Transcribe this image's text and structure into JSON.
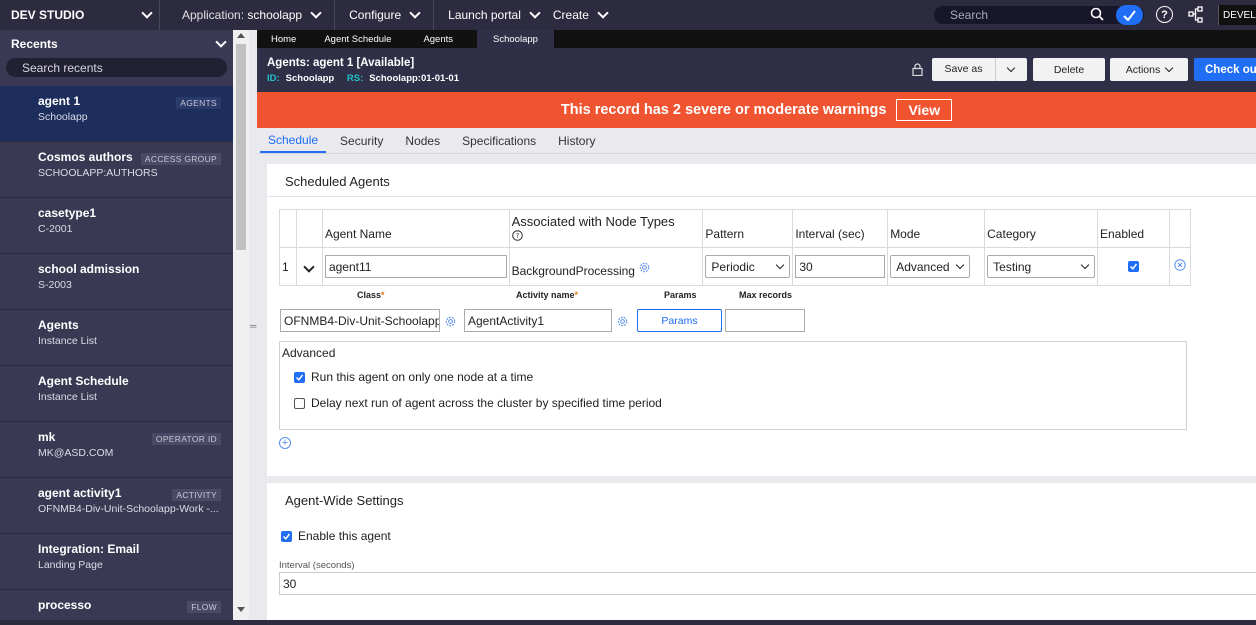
{
  "topbar": {
    "brand": "DEV STUDIO",
    "application_label": "Application:",
    "application_value": "schoolapp",
    "menu": [
      "Configure",
      "Launch portal",
      "Create"
    ],
    "search_placeholder": "Search",
    "help_label": "?",
    "user_badge": "DEVELO"
  },
  "sidebar": {
    "title": "Recents",
    "search_placeholder": "Search recents",
    "items": [
      {
        "title": "agent 1",
        "subtitle": "Schoolapp",
        "badge": "AGENTS"
      },
      {
        "title": "Cosmos authors",
        "subtitle": "SCHOOLAPP:AUTHORS",
        "badge": "ACCESS GROUP"
      },
      {
        "title": "casetype1",
        "subtitle": "C-2001",
        "badge": ""
      },
      {
        "title": "school admission",
        "subtitle": "S-2003",
        "badge": ""
      },
      {
        "title": "Agents",
        "subtitle": "Instance List",
        "badge": ""
      },
      {
        "title": "Agent Schedule",
        "subtitle": "Instance List",
        "badge": ""
      },
      {
        "title": "mk",
        "subtitle": "MK@ASD.COM",
        "badge": "OPERATOR ID"
      },
      {
        "title": "agent activity1",
        "subtitle": "OFNMB4-Div-Unit-Schoolapp-Work -...",
        "badge": "ACTIVITY"
      },
      {
        "title": "Integration: Email",
        "subtitle": "Landing Page",
        "badge": ""
      },
      {
        "title": "processo",
        "subtitle": "",
        "badge": "FLOW"
      }
    ]
  },
  "tabs": [
    "Home",
    "Agent Schedule",
    "Agents",
    "Schoolapp"
  ],
  "record": {
    "title": "Agents: agent 1 [Available]",
    "id_label": "ID:",
    "id_value": "Schoolapp",
    "rs_label": "RS:",
    "rs_value": "Schoolapp:01-01-01",
    "save_as": "Save as",
    "delete": "Delete",
    "actions": "Actions",
    "checkout": "Check out"
  },
  "warning": {
    "text": "This record has 2 severe or moderate warnings",
    "view": "View"
  },
  "subtabs": [
    "Schedule",
    "Security",
    "Nodes",
    "Specifications",
    "History"
  ],
  "scheduled": {
    "title": "Scheduled Agents",
    "columns": [
      "Agent Name",
      "Associated with Node Types",
      "Pattern",
      "Interval (sec)",
      "Mode",
      "Category",
      "Enabled"
    ],
    "row": {
      "index": "1",
      "agent_name": "agent11",
      "node_type": "BackgroundProcessing",
      "pattern": "Periodic",
      "interval": "30",
      "mode": "Advanced",
      "category": "Testing",
      "enabled": true
    },
    "detail": {
      "class_label": "Class",
      "activity_label": "Activity name",
      "params_label": "Params",
      "max_records_label": "Max records",
      "class_value": "OFNMB4-Div-Unit-Schoolapp-",
      "activity_value": "AgentActivity1",
      "params_button": "Params",
      "max_records_value": ""
    },
    "advanced": {
      "title": "Advanced",
      "opt1": "Run this agent on only one node at a time",
      "opt1_checked": true,
      "opt2": "Delay next run of agent across the cluster by specified time period",
      "opt2_checked": false
    }
  },
  "agent_wide": {
    "title": "Agent-Wide Settings",
    "enable_label": "Enable this agent",
    "enable_checked": true,
    "interval_label": "Interval (seconds)",
    "interval_value": "30"
  }
}
